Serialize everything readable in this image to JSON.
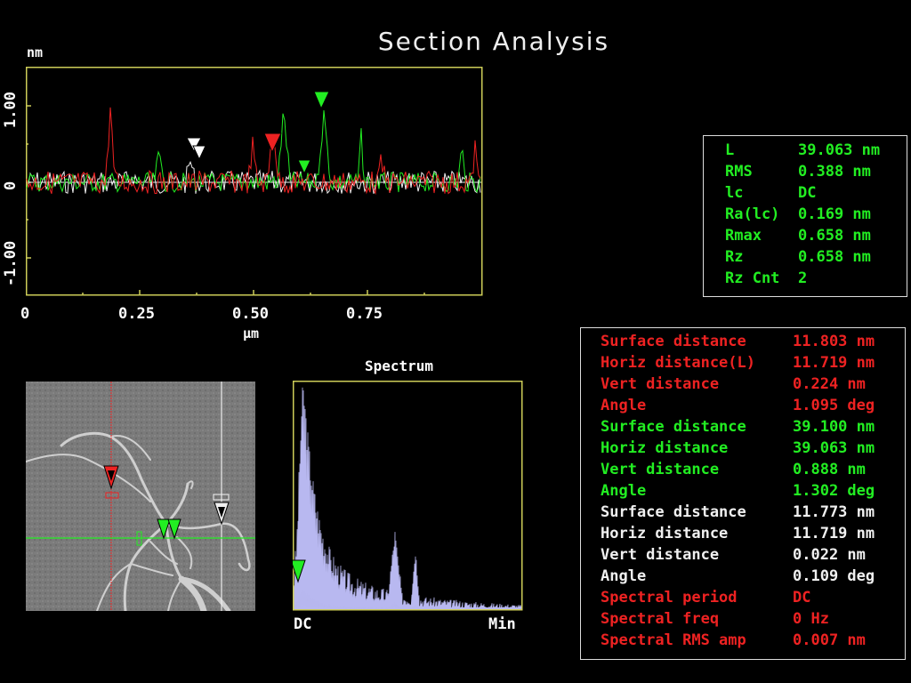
{
  "title": "Section Analysis",
  "profile": {
    "y_unit": "nm",
    "x_unit": "µm",
    "y_ticks": [
      "1.00",
      "0",
      "-1.00"
    ],
    "x_ticks": [
      "0",
      "0.25",
      "0.50",
      "0.75"
    ]
  },
  "stats": [
    {
      "label": "L",
      "value": "39.063 nm"
    },
    {
      "label": "RMS",
      "value": "0.388 nm"
    },
    {
      "label": "lc",
      "value": "DC"
    },
    {
      "label": "Ra(lc)",
      "value": "0.169 nm"
    },
    {
      "label": "Rmax",
      "value": "0.658 nm"
    },
    {
      "label": "Rz",
      "value": "0.658 nm"
    },
    {
      "label": "Rz Cnt",
      "value": "2"
    }
  ],
  "measurements": [
    {
      "label": "Surface distance",
      "value": "11.803 nm",
      "color": "#ee2222"
    },
    {
      "label": "Horiz distance(L)",
      "value": "11.719 nm",
      "color": "#ee2222"
    },
    {
      "label": "Vert distance",
      "value": "0.224 nm",
      "color": "#ee2222"
    },
    {
      "label": "Angle",
      "value": "1.095 deg",
      "color": "#ee2222"
    },
    {
      "label": "Surface distance",
      "value": "39.100 nm",
      "color": "#22ee22"
    },
    {
      "label": "Horiz distance",
      "value": "39.063 nm",
      "color": "#22ee22"
    },
    {
      "label": "Vert distance",
      "value": "0.888 nm",
      "color": "#22ee22"
    },
    {
      "label": "Angle",
      "value": "1.302 deg",
      "color": "#22ee22"
    },
    {
      "label": "Surface distance",
      "value": "11.773 nm",
      "color": "#f0f0f0"
    },
    {
      "label": "Horiz distance",
      "value": "11.719 nm",
      "color": "#f0f0f0"
    },
    {
      "label": "Vert distance",
      "value": "0.022 nm",
      "color": "#f0f0f0"
    },
    {
      "label": "Angle",
      "value": "0.109 deg",
      "color": "#f0f0f0"
    },
    {
      "label": "Spectral period",
      "value": "DC",
      "color": "#ee2222"
    },
    {
      "label": "Spectral freq",
      "value": "0 Hz",
      "color": "#ee2222"
    },
    {
      "label": "Spectral RMS amp",
      "value": "0.007 nm",
      "color": "#ee2222"
    }
  ],
  "spectrum": {
    "title": "Spectrum",
    "x_start": "DC",
    "x_end": "Min"
  },
  "colors": {
    "red": "#ee2222",
    "green": "#22ee22",
    "white": "#f0f0f0",
    "frame": "#cdcd58",
    "spectrum_fill": "#b8b8f0"
  }
}
